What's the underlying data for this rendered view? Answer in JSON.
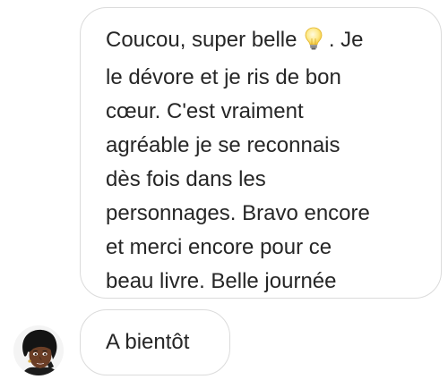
{
  "thread": {
    "message_1": {
      "lines": [
        "Coucou, super belle",
        ". Je",
        "le dévore et je ris de bon",
        "cœur. C'est vraiment",
        "agréable je se reconnais",
        "dès fois dans les",
        "personnages. Bravo encore",
        "et merci encore pour ce",
        "beau livre. Belle journée"
      ],
      "emoji": "light-bulb-icon"
    },
    "message_2": {
      "text": "A bientôt"
    },
    "sender_avatar": "avatar-icon"
  },
  "colors": {
    "bubble_border": "#dbdbdb",
    "text": "#262626",
    "background": "#ffffff"
  }
}
